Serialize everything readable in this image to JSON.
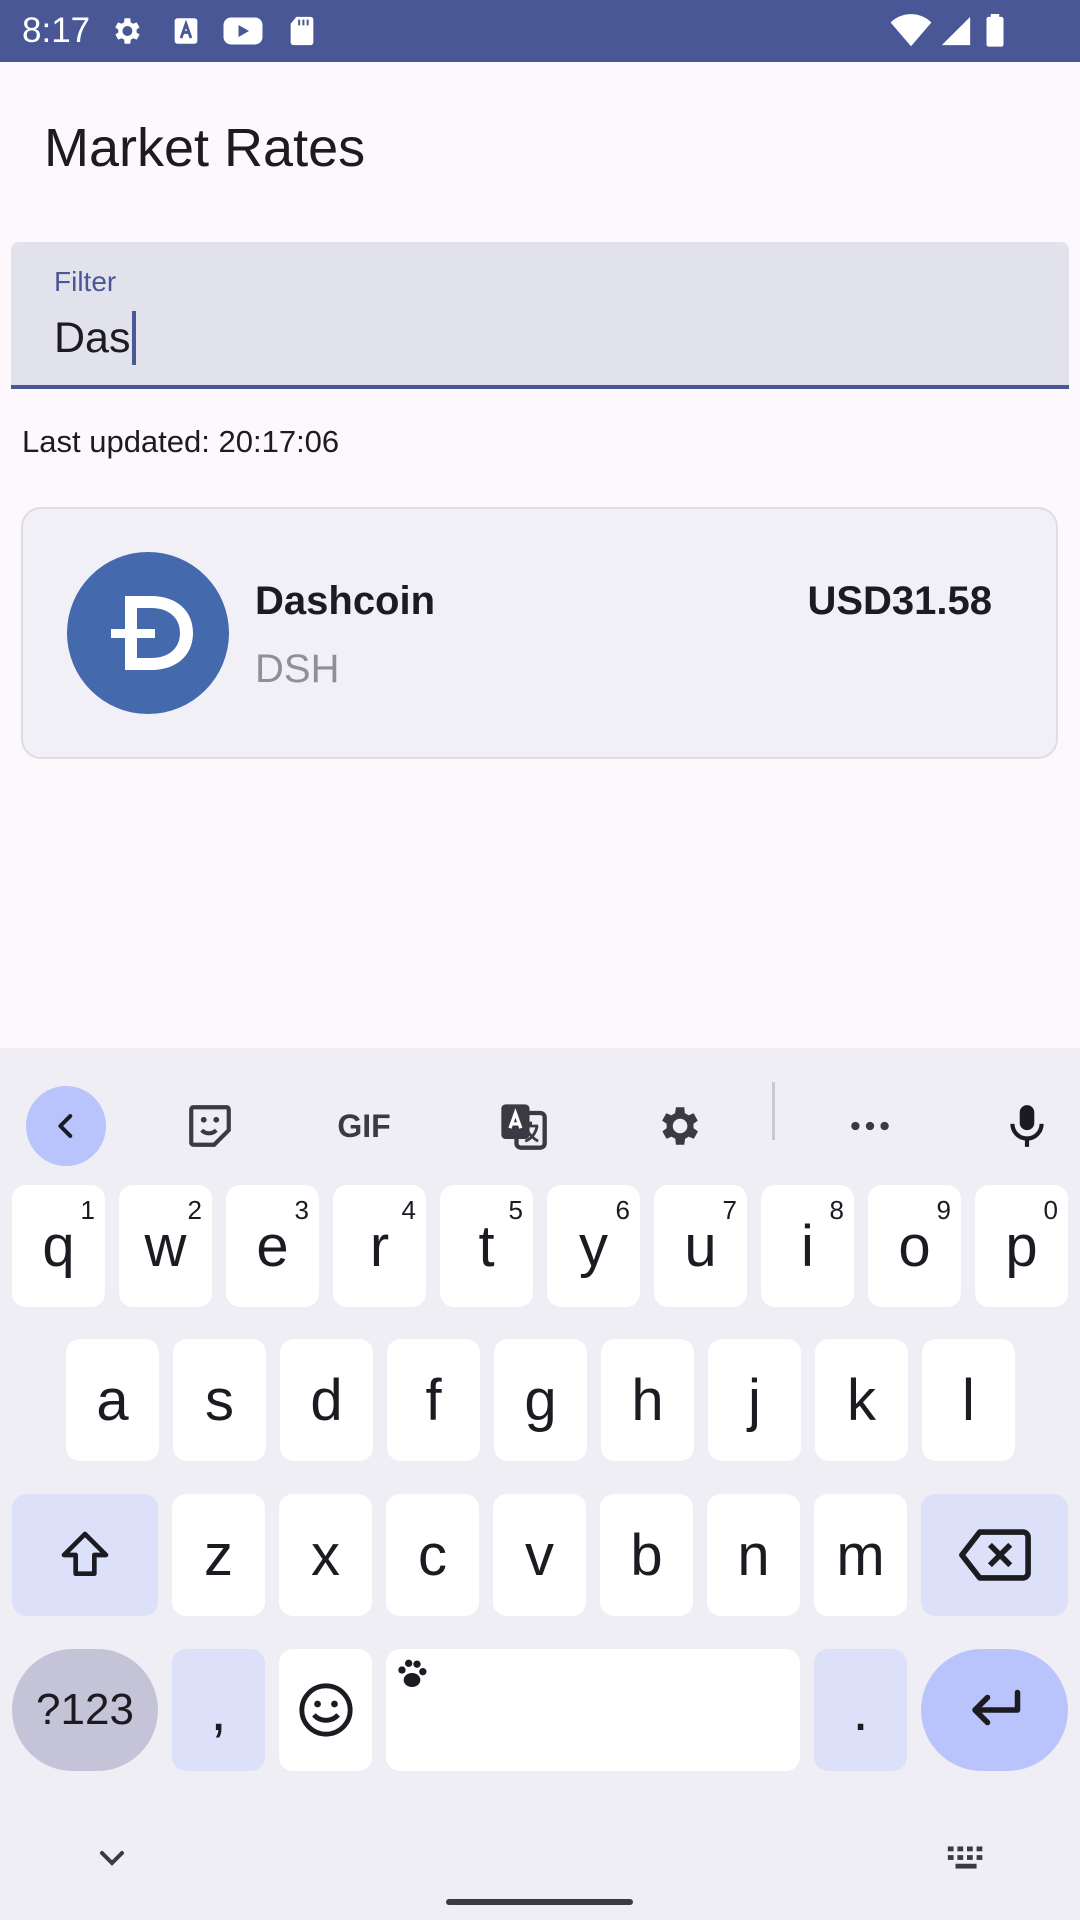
{
  "status_bar": {
    "time": "8:17",
    "left_icons": [
      "gear-icon",
      "font-a-icon",
      "youtube-icon",
      "sd-card-icon"
    ],
    "right_icons": [
      "wifi-icon",
      "signal-icon",
      "battery-icon"
    ]
  },
  "app": {
    "title": "Market Rates",
    "filter": {
      "label": "Filter",
      "value": "Das"
    },
    "last_updated": "Last updated: 20:17:06",
    "coins": [
      {
        "name": "Dashcoin",
        "symbol": "DSH",
        "price": "USD31.58",
        "logo_letter": "Đ",
        "logo_color": "#4469ad"
      }
    ]
  },
  "keyboard": {
    "toolbar": [
      "back-icon",
      "sticker-icon",
      "gif-icon",
      "translate-icon",
      "settings-icon",
      "more-icon",
      "mic-icon"
    ],
    "gif_label": "GIF",
    "row1": [
      {
        "k": "q",
        "h": "1"
      },
      {
        "k": "w",
        "h": "2"
      },
      {
        "k": "e",
        "h": "3"
      },
      {
        "k": "r",
        "h": "4"
      },
      {
        "k": "t",
        "h": "5"
      },
      {
        "k": "y",
        "h": "6"
      },
      {
        "k": "u",
        "h": "7"
      },
      {
        "k": "i",
        "h": "8"
      },
      {
        "k": "o",
        "h": "9"
      },
      {
        "k": "p",
        "h": "0"
      }
    ],
    "row2": [
      "a",
      "s",
      "d",
      "f",
      "g",
      "h",
      "j",
      "k",
      "l"
    ],
    "row3": [
      "z",
      "x",
      "c",
      "v",
      "b",
      "n",
      "m"
    ],
    "symbols_label": "?123",
    "comma": ",",
    "period": ".",
    "colors": {
      "accent": "#4a5797",
      "special_key": "#dde0f9",
      "enter_key": "#b8c4fb"
    }
  }
}
